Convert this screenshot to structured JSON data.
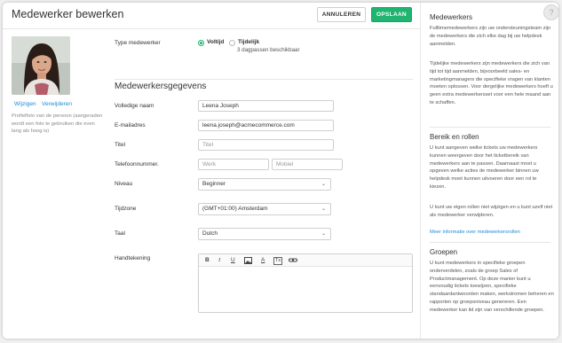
{
  "header": {
    "title": "Medewerker bewerken",
    "cancel_label": "ANNULEREN",
    "save_label": "OPSLAAN"
  },
  "photo": {
    "change_label": "Wijzigen",
    "remove_label": "Verwijderen",
    "help_text": "Profielfoto van de persoon (aangeraden wordt een foto te gebruiken die even lang als hoog is)"
  },
  "type": {
    "label": "Type medewerker",
    "options": [
      {
        "label": "Voltijd",
        "selected": true
      },
      {
        "label": "Tijdelijk",
        "selected": false
      }
    ],
    "day_pass_note": "3 dagpassen beschikbaar"
  },
  "details": {
    "section_title": "Medewerkersgegevens",
    "full_name": {
      "label": "Volledige naam",
      "value": "Leena Joseph"
    },
    "email": {
      "label": "E-mailadres",
      "value": "leena.joseph@acmecommerce.com"
    },
    "title": {
      "label": "Titel",
      "placeholder": "Titel"
    },
    "phone": {
      "label": "Telefoonnummer.",
      "work_placeholder": "Werk",
      "mobile_placeholder": "Mobiel"
    },
    "level": {
      "label": "Niveau",
      "value": "Beginner"
    },
    "timezone": {
      "label": "Tijdzone",
      "value": "(GMT+01:00) Amsterdam"
    },
    "language": {
      "label": "Taal",
      "value": "Dutch"
    },
    "signature": {
      "label": "Handtekening",
      "toolbar": [
        "B",
        "I",
        "U",
        "image",
        "A",
        "Tx",
        "link"
      ]
    }
  },
  "sidebar": {
    "h1": "Medewerkers",
    "p1": "Fulltimemedewerkers zijn uw ondersteuningsteam zijn de medewerkers die zich elke dag bij uw helpdesk aanmelden.",
    "p2": "Tijdelijke medewerkers zijn medewerkers die zich van tijd tot tijd aanmelden, bijvoorbeeld sales- en marketingmanagers die specifieke vragen van klanten moeten oplossen. Voor dergelijke medewerkers hoeft u geen extra medewerkersset voor een hele maand aan te schaffen.",
    "h2": "Bereik en rollen",
    "p3": "U kunt aangeven welke tickets uw medewerkers kunnen weergeven door het ticketbereik van medewerkers aan te passen. Daarnaast moet u opgeven welke acties de medewerker binnen uw helpdesk moet kunnen uitvoeren door een rol te kiezen.",
    "p4": "U kunt uw eigen rollen niet wijzigen en u kunt uzelf niet als medewerker verwijderen.",
    "link": "Meer informatie over medewerkersrollen",
    "h3": "Groepen",
    "p5": "U kunt medewerkers in specifieke groepen onderverdelen, zoals de groep Sales of Productmanagement. Op deze manier kunt u eenvoudig tickets toewijzen, specifieke standaardantwoorden maken, werkstromen beheren en rapporten op groepsniveau genereren. Een medewerker kan lid zijn van verschillende groepen."
  },
  "help_glyph": "?",
  "colors": {
    "accent": "#1fb470",
    "link": "#1f8ad6"
  }
}
